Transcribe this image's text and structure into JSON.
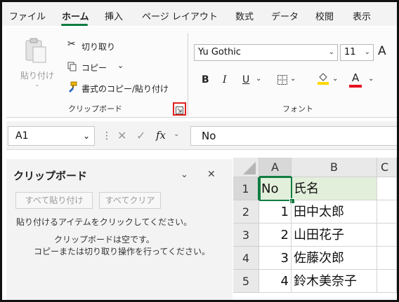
{
  "tabs": [
    "ファイル",
    "ホーム",
    "挿入",
    "ページ レイアウト",
    "数式",
    "データ",
    "校閲",
    "表示"
  ],
  "active_tab": "ホーム",
  "accent_color": "#107c41",
  "clipboard_group": {
    "paste_label": "貼り付け",
    "cut_label": "切り取り",
    "copy_label": "コピー",
    "format_painter_label": "書式のコピー/貼り付け",
    "group_label": "クリップボード"
  },
  "font_group": {
    "font_name": "Yu Gothic",
    "font_size": "11",
    "grow_label": "A",
    "bold": "B",
    "italic": "I",
    "underline": "U",
    "font_color_letter": "A",
    "group_label": "フォント",
    "fill_color": "#ffd800",
    "font_color": "#e81123"
  },
  "formula_bar": {
    "name_box": "A1",
    "fx_label": "fx",
    "content": "No"
  },
  "clipboard_pane": {
    "title": "クリップボード",
    "paste_all_button": "すべて貼り付け",
    "clear_all_button": "すべてクリア",
    "instruction": "貼り付けるアイテムをクリックしてください。",
    "empty_line1": "クリップボードは空です。",
    "empty_line2": "コピーまたは切り取り操作を行ってください。"
  },
  "sheet": {
    "columns": [
      "A",
      "B",
      "C"
    ],
    "rows": [
      {
        "num": "1",
        "a": "No",
        "b": "氏名"
      },
      {
        "num": "2",
        "a": "1",
        "b": "田中太郎"
      },
      {
        "num": "3",
        "a": "2",
        "b": "山田花子"
      },
      {
        "num": "4",
        "a": "3",
        "b": "佐藤次郎"
      },
      {
        "num": "5",
        "a": "4",
        "b": "鈴木美奈子"
      }
    ]
  }
}
